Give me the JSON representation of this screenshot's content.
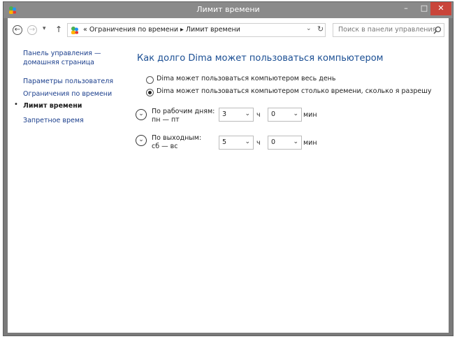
{
  "window": {
    "title": "Лимит времени",
    "min_glyph": "–",
    "max_glyph": "□",
    "close_glyph": "✕"
  },
  "nav": {
    "back_glyph": "←",
    "forward_glyph": "→",
    "recent_glyph": "▾",
    "up_glyph": "↑",
    "breadcrumb": "« Ограничения по времени ▸ Лимит времени",
    "dropdown_glyph": "⌄",
    "refresh_glyph": "↻",
    "search_placeholder": "Поиск в панели управления"
  },
  "sidebar": {
    "home_line1": "Панель управления —",
    "home_line2": "домашняя страница",
    "items": [
      {
        "label": "Параметры пользователя"
      },
      {
        "label": "Ограничения по времени"
      },
      {
        "label": "Лимит времени"
      },
      {
        "label": "Запретное время"
      }
    ],
    "current_marker": "•"
  },
  "main": {
    "heading": "Как долго Dima может пользоваться компьютером",
    "options": [
      {
        "label": "Dima может пользоваться компьютером весь день",
        "selected": false
      },
      {
        "label": "Dima может пользоваться компьютером столько времени, сколько я разрешу",
        "selected": true
      }
    ],
    "weekdays": {
      "label_line1": "По рабочим дням:",
      "label_line2": "пн — пт",
      "hours": "3",
      "minutes": "0"
    },
    "weekend": {
      "label_line1": "По выходным:",
      "label_line2": "сб — вс",
      "hours": "5",
      "minutes": "0"
    },
    "hours_unit": "ч",
    "minutes_unit": "мин",
    "expander_glyph": "⌄",
    "select_arrow": "⌄"
  }
}
